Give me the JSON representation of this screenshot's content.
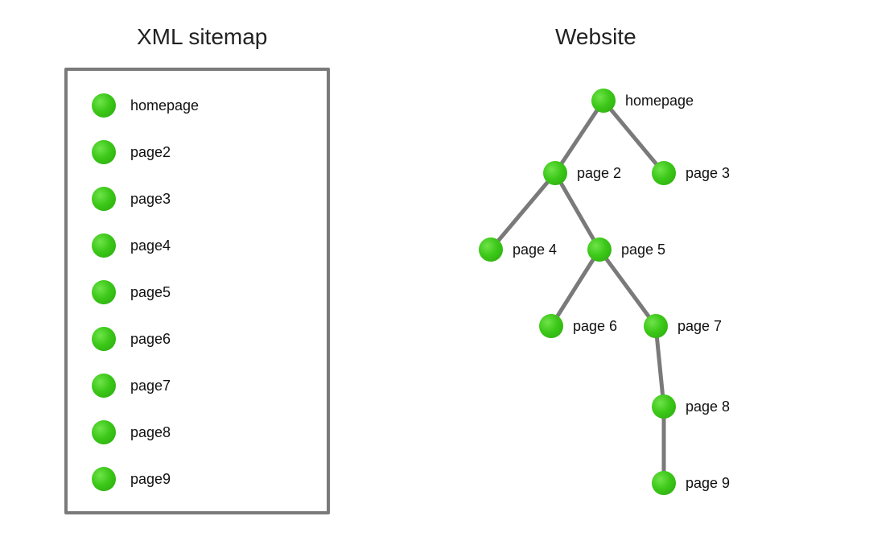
{
  "headings": {
    "left": "XML sitemap",
    "right": "Website"
  },
  "sitemap_items": [
    "homepage",
    "page2",
    "page3",
    "page4",
    "page5",
    "page6",
    "page7",
    "page8",
    "page9"
  ],
  "tree": {
    "nodes": {
      "homepage": "homepage",
      "page2": "page 2",
      "page3": "page 3",
      "page4": "page 4",
      "page5": "page 5",
      "page6": "page 6",
      "page7": "page 7",
      "page8": "page 8",
      "page9": "page 9"
    }
  },
  "colors": {
    "node_fill": "#3cc818",
    "edge": "#7a7a7a",
    "border": "#7a7a7a"
  }
}
